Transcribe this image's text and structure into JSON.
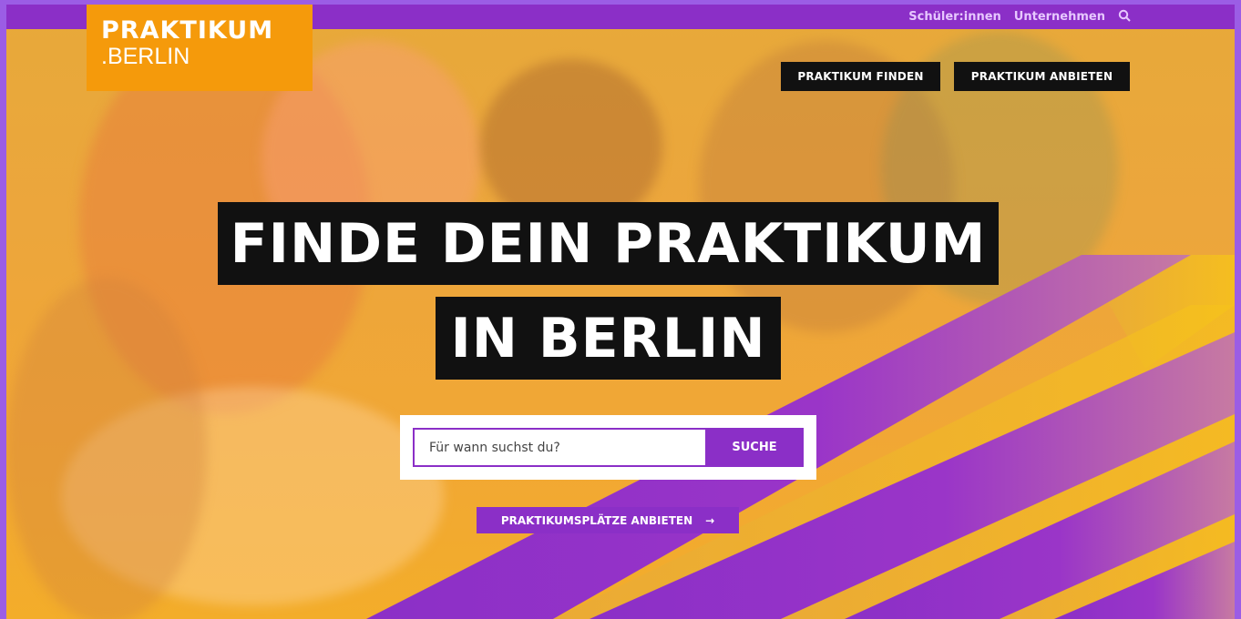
{
  "site": {
    "logo_line1": "PRAKTIKUM",
    "logo_line2": ".BERLIN"
  },
  "topnav": {
    "students": "Schüler:innen",
    "companies": "Unternehmen",
    "search_icon": "search-icon"
  },
  "mainnav": {
    "find": "PRAKTIKUM FINDEN",
    "offer": "PRAKTIKUM ANBIETEN"
  },
  "hero": {
    "line1": "FINDE DEIN PRAKTIKUM",
    "line2": "IN BERLIN"
  },
  "search": {
    "placeholder": "Für wann suchst du?",
    "button": "SUCHE"
  },
  "cta": {
    "label": "PRAKTIKUMSPLÄTZE ANBIETEN",
    "arrow": "→"
  },
  "colors": {
    "purple": "#8b2fc7",
    "orange": "#f59a0b",
    "yellow": "#f6c21b",
    "black": "#111111"
  }
}
